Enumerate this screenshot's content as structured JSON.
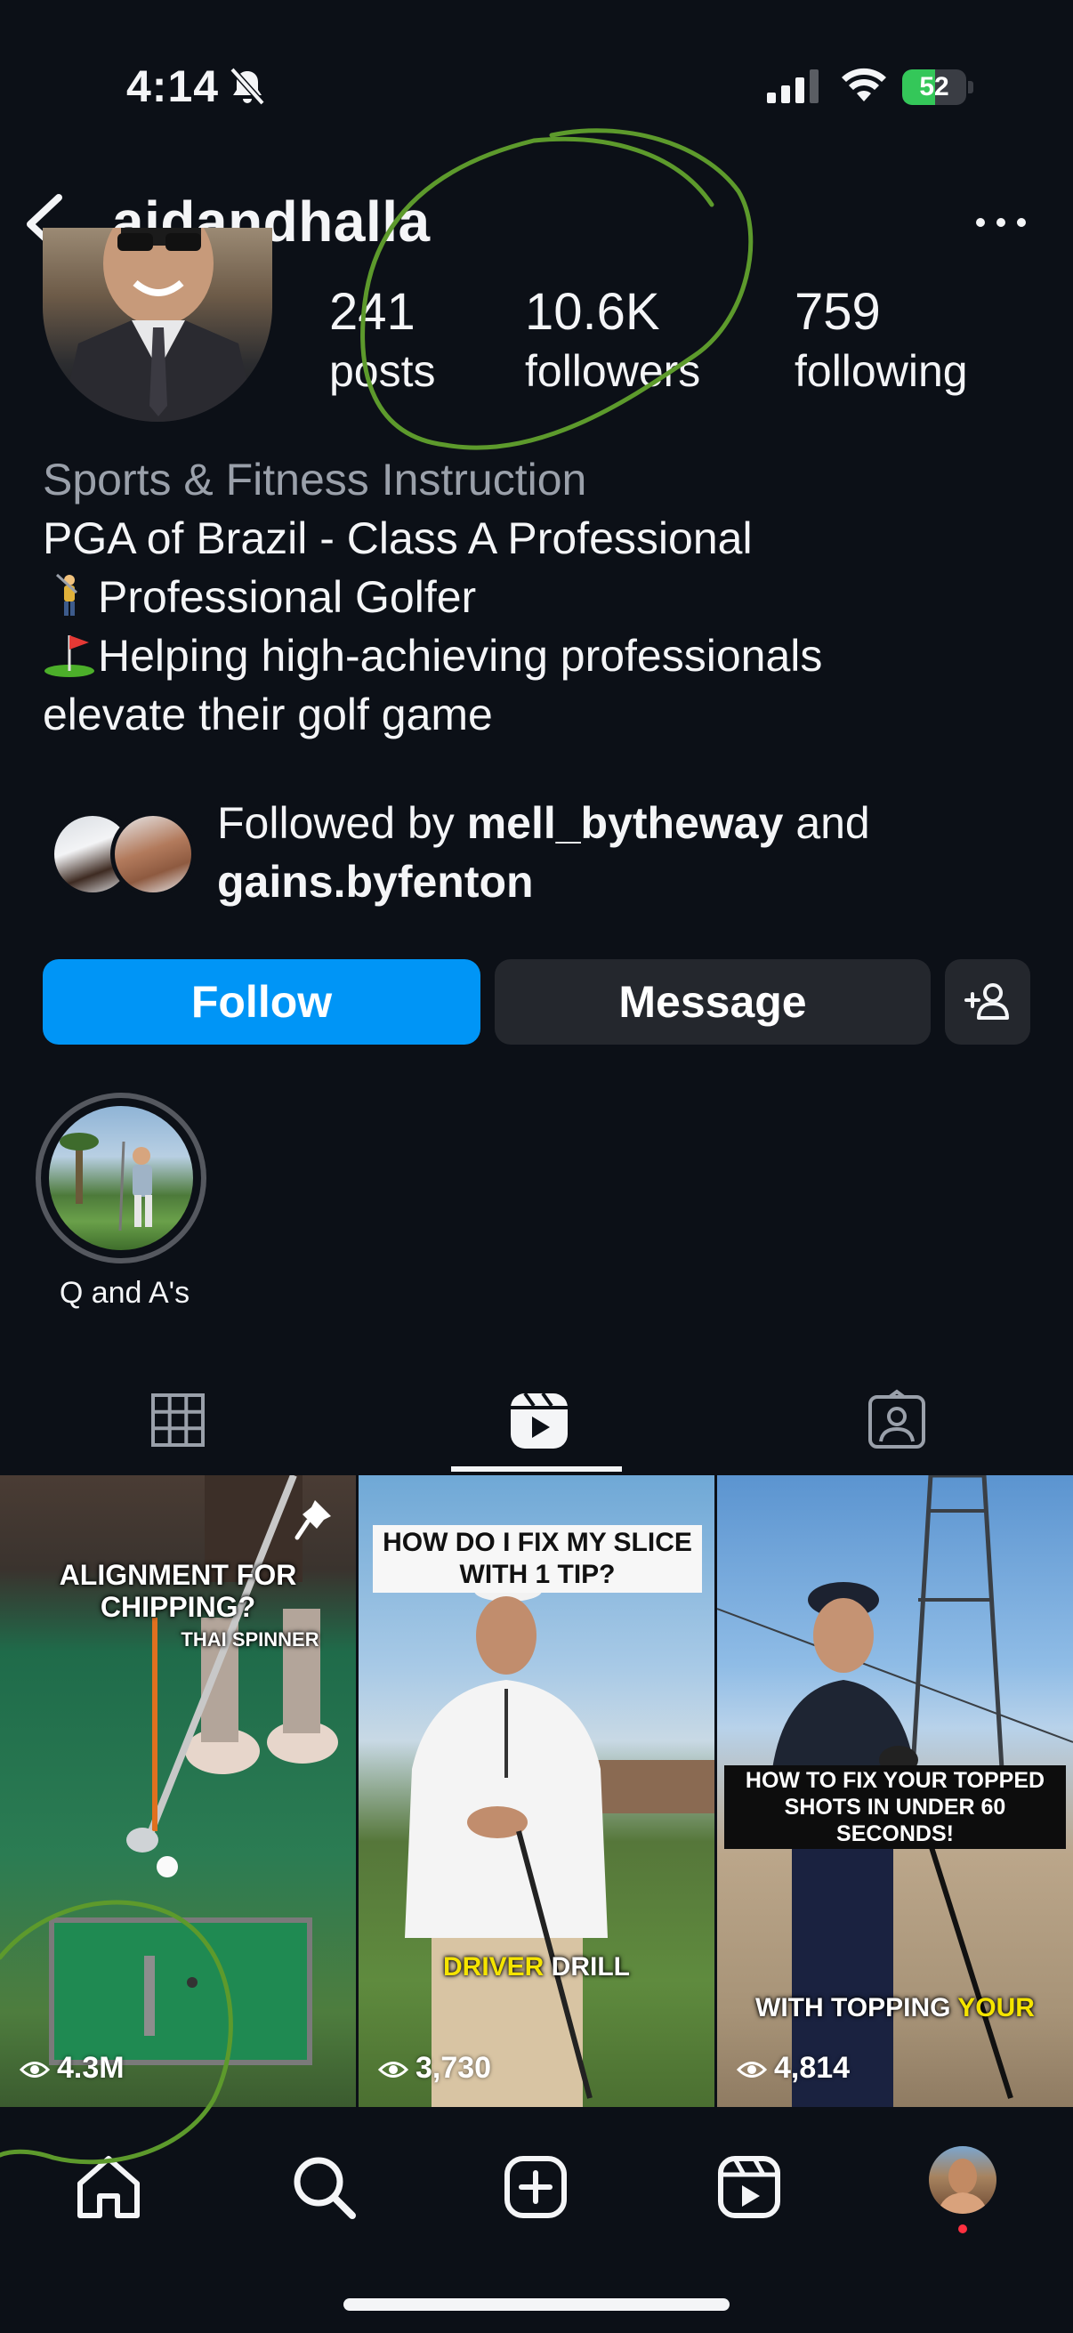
{
  "status_bar": {
    "time": "4:14",
    "battery_percent": 52,
    "battery_label": "52",
    "icons": [
      "bell-slash-icon",
      "cellular-signal-icon",
      "wifi-icon",
      "battery-charging-icon"
    ]
  },
  "header": {
    "username": "aidandhalla",
    "back_icon": "chevron-left-icon",
    "more_icon": "ellipsis-icon"
  },
  "stats": {
    "posts": {
      "value": "241",
      "label": "posts"
    },
    "followers": {
      "value": "10.6K",
      "label": "followers"
    },
    "following": {
      "value": "759",
      "label": "following"
    }
  },
  "bio": {
    "category": "Sports & Fitness Instruction",
    "line1": "PGA of Brazil - Class A Professional",
    "line2": "Professional Golfer",
    "line3": "Helping high-achieving professionals",
    "line4": "elevate their golf game"
  },
  "followed_by": {
    "prefix": "Followed by ",
    "user1": "mell_bytheway",
    "joiner": " and",
    "user2": "gains.byfenton"
  },
  "actions": {
    "follow": "Follow",
    "message": "Message",
    "add_user_icon": "person-plus-icon"
  },
  "highlights": [
    {
      "label": "Q and A's"
    }
  ],
  "tabs": [
    {
      "name": "grid",
      "icon": "grid-icon",
      "active": false
    },
    {
      "name": "reels",
      "icon": "reels-icon",
      "active": true
    },
    {
      "name": "tagged",
      "icon": "tagged-person-icon",
      "active": false
    }
  ],
  "reels": [
    {
      "caption": "ALIGNMENT FOR CHIPPING?",
      "subcaption": "THAI SPINNER",
      "views": "4.3M",
      "pinned": true
    },
    {
      "caption": "HOW DO I FIX MY SLICE WITH 1 TIP?",
      "overlay_highlight": "DRIVER",
      "overlay_rest": " DRILL",
      "views": "3,730",
      "pinned": false
    },
    {
      "caption": "HOW TO FIX YOUR TOPPED SHOTS IN UNDER 60 SECONDS!",
      "overlay_rest": "WITH TOPPING ",
      "overlay_highlight": "YOUR",
      "views": "4,814",
      "pinned": false
    }
  ],
  "bottom_nav": [
    {
      "name": "home",
      "icon": "home-icon"
    },
    {
      "name": "search",
      "icon": "search-icon"
    },
    {
      "name": "create",
      "icon": "plus-square-icon"
    },
    {
      "name": "reels",
      "icon": "reels-icon"
    },
    {
      "name": "profile",
      "icon": "profile-avatar"
    }
  ],
  "colors": {
    "background": "#0c1017",
    "follow_button": "#0095f6",
    "secondary_button": "#24272d",
    "annotation_stroke": "#5d9a2c",
    "notification_dot": "#ff3040",
    "battery_green": "#34c759",
    "caption_yellow": "#f5e400"
  }
}
